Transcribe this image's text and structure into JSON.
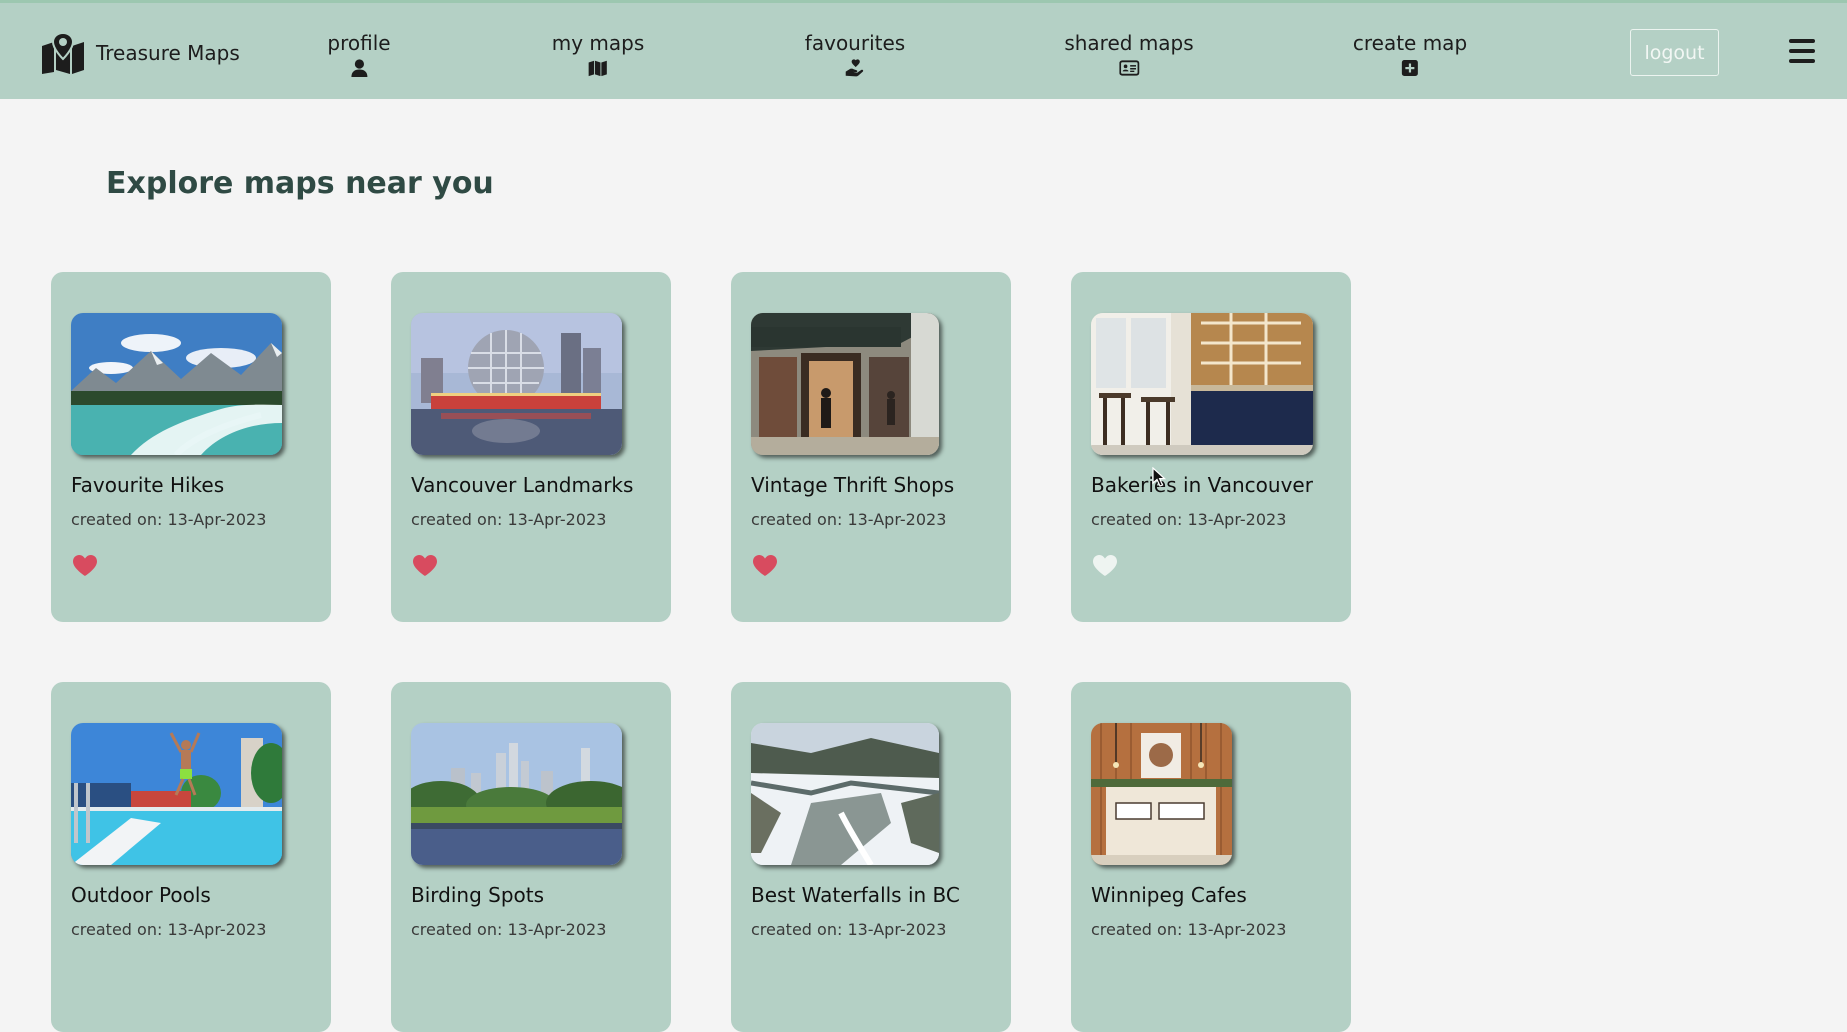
{
  "brand": {
    "name": "Treasure Maps",
    "logo_icon": "map-pin-logo-icon"
  },
  "nav": [
    {
      "label": "profile",
      "icon": "user-icon"
    },
    {
      "label": "my maps",
      "icon": "map-icon"
    },
    {
      "label": "favourites",
      "icon": "hand-heart-icon"
    },
    {
      "label": "shared maps",
      "icon": "address-card-icon"
    },
    {
      "label": "create map",
      "icon": "plus-square-icon"
    }
  ],
  "logout_label": "logout",
  "menu_icon": "hamburger-icon",
  "heading": "Explore maps near you",
  "colors": {
    "navbar": "#b4d0c5",
    "card": "#b4d0c5",
    "heart_active": "#d84b5f",
    "heart_inactive": "#eef4f1",
    "background": "#f4f4f4"
  },
  "cards": [
    {
      "title": "Favourite Hikes",
      "date": "created on: 13-Apr-2023",
      "favourited": true
    },
    {
      "title": "Vancouver Landmarks",
      "date": "created on: 13-Apr-2023",
      "favourited": true
    },
    {
      "title": "Vintage Thrift Shops",
      "date": "created on: 13-Apr-2023",
      "favourited": true
    },
    {
      "title": "Bakeries in Vancouver",
      "date": "created on: 13-Apr-2023",
      "favourited": false
    },
    {
      "title": "Outdoor Pools",
      "date": "created on: 13-Apr-2023",
      "favourited": false
    },
    {
      "title": "Birding Spots",
      "date": "created on: 13-Apr-2023",
      "favourited": false
    },
    {
      "title": "Best Waterfalls in BC",
      "date": "created on: 13-Apr-2023",
      "favourited": false
    },
    {
      "title": "Winnipeg Cafes",
      "date": "created on: 13-Apr-2023",
      "favourited": false
    }
  ]
}
